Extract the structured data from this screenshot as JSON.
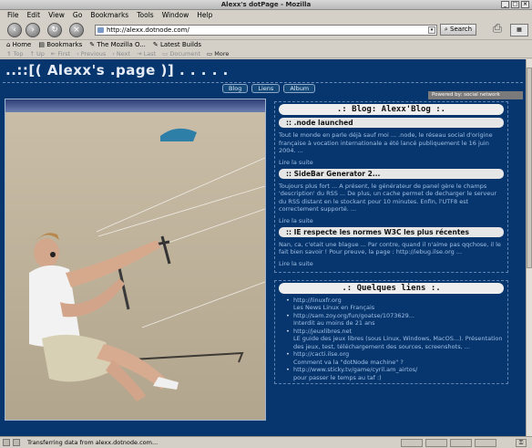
{
  "window": {
    "title": "Alexx's dotPage - Mozilla"
  },
  "menu": [
    "File",
    "Edit",
    "View",
    "Go",
    "Bookmarks",
    "Tools",
    "Window",
    "Help"
  ],
  "toolbar": {
    "url": "http://alexx.dotnode.com/",
    "search_label": "Search"
  },
  "bookmarks": [
    "Home",
    "Bookmarks",
    "The Mozilla O...",
    "Latest Builds"
  ],
  "site_nav": [
    "Top",
    "Up",
    "First",
    "Previous",
    "Next",
    "Last",
    "Document",
    "More"
  ],
  "page": {
    "site_title": "..::[( Alexx's .page )] . . . . .",
    "tabs": [
      "Blog",
      "Liens",
      "Album"
    ],
    "powered": "Powered by:        social network"
  },
  "blog": {
    "heading": ".: Blog: Alexx'Blog :.",
    "posts": [
      {
        "title": ":: .node launched",
        "body": "Tout le monde en parle déjà sauf moi ... .node, le réseau social d'origine française à vocation internationale a été lancé publiquement le 16 juin 2004. ...",
        "more": "Lire la suite"
      },
      {
        "title": ":: SideBar Generator 2...",
        "body": "Toujours plus fort ... A présent, le générateur de panel gère le champs 'description' du RSS ... De plus, un cache permet de decharger le serveur du RSS distant en le stockant pour 10 minutes. Enfin, l'UTF8 est correctement supporté. ...",
        "more": "Lire la suite"
      },
      {
        "title": ":: IE respecte les normes W3C les plus récentes",
        "body": "Nan, ca, c'etait une blague ... Par contre, quand il n'aime pas qqchose, il le fait bien savoir ! Pour preuve, la page : http://iebug.ilse.org ...",
        "more": "Lire la suite"
      }
    ]
  },
  "links": {
    "heading": ".: Quelques liens :.",
    "items": [
      {
        "url": "http://linuxfr.org",
        "desc": "Les News Linux en Français"
      },
      {
        "url": "http://sam.zoy.org/fun/goatse/1073629...",
        "desc": "Interdit au moins de 21 ans"
      },
      {
        "url": "http://jeuxlibres.net",
        "desc": "LE guide des jeux libres (sous Linux, Windows, MacOS...). Présentation des jeux, test, téléchargement des sources, screenshots, ..."
      },
      {
        "url": "http://cacti.ilse.org",
        "desc": "Comment va la \"dotNode machine\" ?"
      },
      {
        "url": "http://www.sticky.tv/game/cyril.am_airtos/",
        "desc": "pour passer le temps au taf :)"
      }
    ]
  },
  "status": {
    "text": "Transferring data from alexx.dotnode.com..."
  },
  "colors": {
    "page_bg": "#07356d",
    "link_text": "#9fc0e6",
    "box_border": "#5f84b3"
  }
}
